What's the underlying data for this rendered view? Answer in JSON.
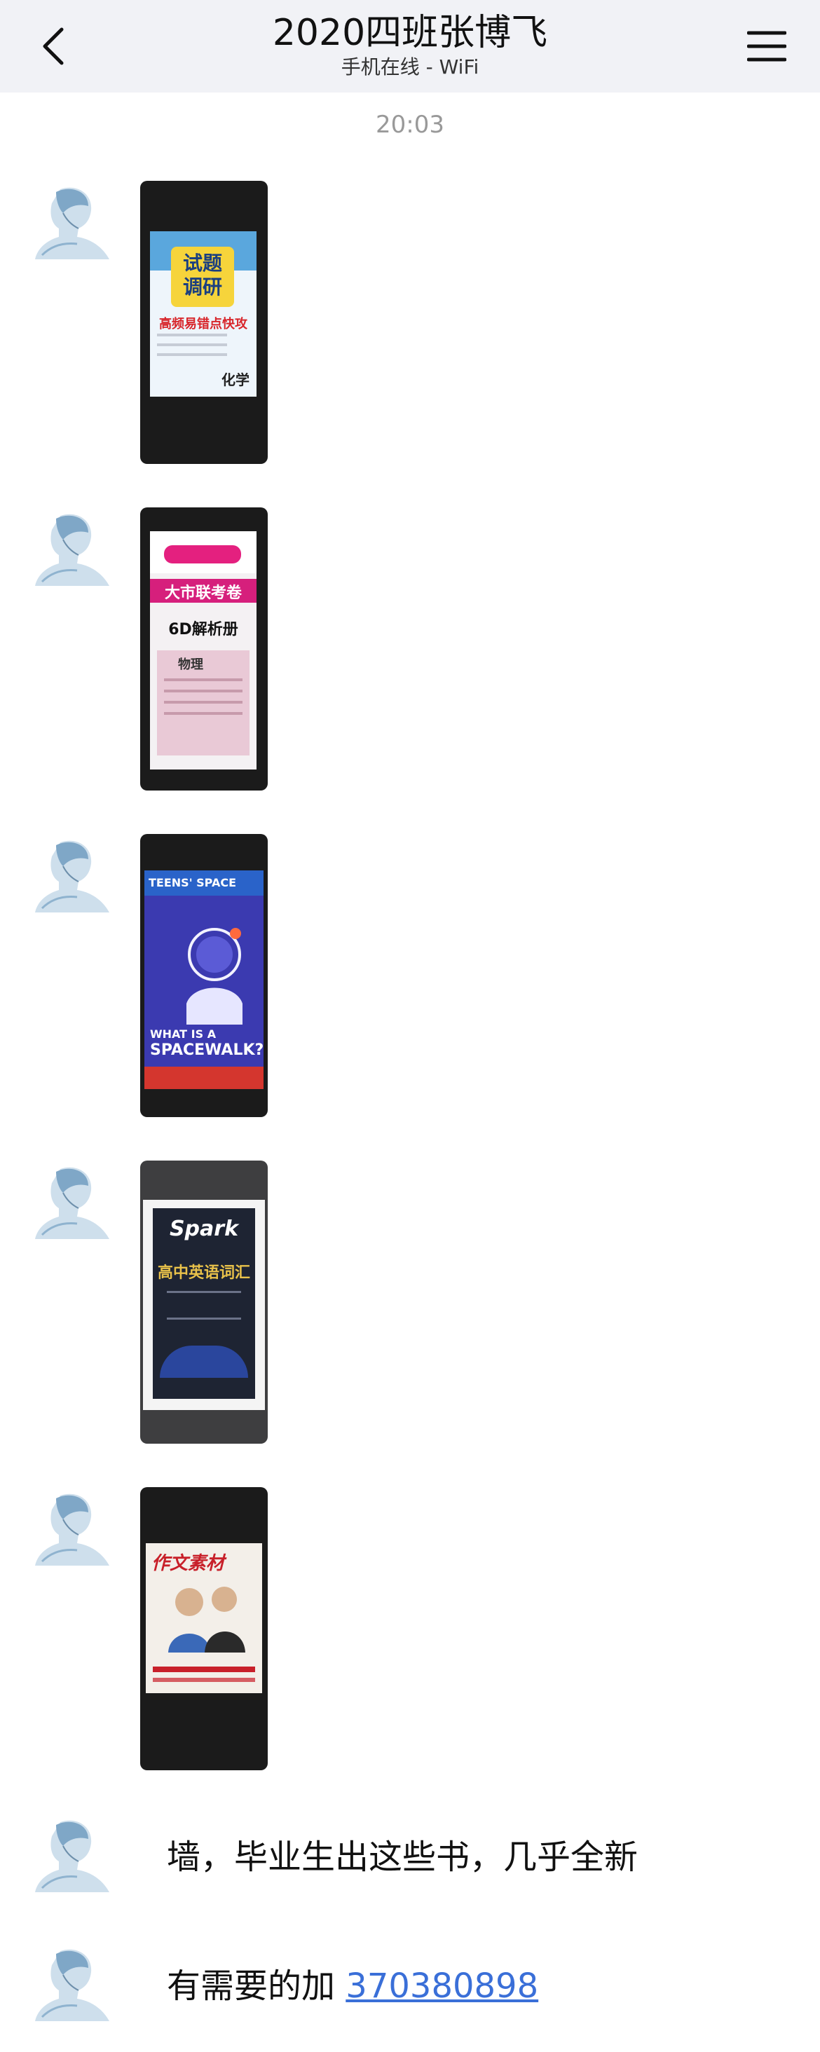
{
  "header": {
    "title": "2020四班张博飞",
    "subtitle": "手机在线 - WiFi"
  },
  "timestamp": "20:03",
  "messages": [
    {
      "type": "image",
      "name": "book-photo-chemistry",
      "cover_lines": [
        "试题",
        "调研",
        "高频易错点快攻",
        "化学"
      ]
    },
    {
      "type": "image",
      "name": "book-photo-physics",
      "cover_lines": [
        "大市联考卷",
        "6D解析册",
        "物理"
      ]
    },
    {
      "type": "image",
      "name": "book-photo-teens-space",
      "cover_lines": [
        "TEENS' SPACE",
        "WHAT IS A",
        "SPACEWALK?"
      ]
    },
    {
      "type": "image",
      "name": "book-photo-spark",
      "cover_lines": [
        "Spark",
        "高中英语词汇"
      ]
    },
    {
      "type": "image",
      "name": "book-photo-writing-material",
      "cover_lines": [
        "作文素材"
      ]
    },
    {
      "type": "text",
      "text": "墙，毕业生出这些书，几乎全新"
    },
    {
      "type": "text",
      "text": "有需要的加",
      "link": "370380898"
    }
  ],
  "colors": {
    "topbar": "#f1f2f6",
    "link": "#3a6fd8",
    "photo_bg": "#1b1b1b"
  }
}
